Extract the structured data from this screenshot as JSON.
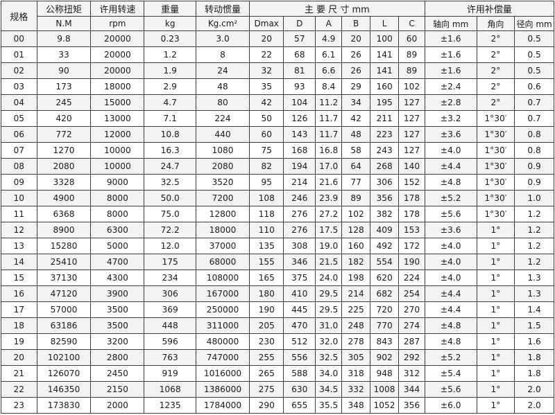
{
  "header": {
    "spec": "规格",
    "torque": "公称扭矩",
    "torque_unit": "N.M",
    "speed": "许用转速",
    "speed_unit": "rpm",
    "weight": "重量",
    "weight_unit": "kg",
    "inertia": "转动惯量",
    "inertia_unit": "Kg.cm²",
    "dims": "主 要 尺 寸 mm",
    "dims_cols": [
      "Dmax",
      "D",
      "A",
      "B",
      "L",
      "C"
    ],
    "comp": "许用补偿量",
    "comp_cols": [
      "轴向 mm",
      "角向",
      "径向 mm"
    ]
  },
  "rows": [
    [
      "00",
      "9.8",
      "20000",
      "0.23",
      "3.0",
      "20",
      "57",
      "4.9",
      "20",
      "100",
      "60",
      "±1.6",
      "2°",
      "0.5"
    ],
    [
      "01",
      "33",
      "20000",
      "1.2",
      "8",
      "22",
      "68",
      "6.1",
      "26",
      "141",
      "89",
      "±1.6",
      "2°",
      "0.5"
    ],
    [
      "02",
      "90",
      "20000",
      "1.9",
      "24",
      "32",
      "81",
      "6.6",
      "26",
      "141",
      "89",
      "±1.6",
      "2°",
      "0.5"
    ],
    [
      "03",
      "173",
      "18000",
      "2.9",
      "48",
      "35",
      "93",
      "8.4",
      "29",
      "160",
      "102",
      "±2.4",
      "2°",
      "0.6"
    ],
    [
      "04",
      "245",
      "15000",
      "4.7",
      "80",
      "42",
      "104",
      "11.2",
      "34",
      "195",
      "127",
      "±2.8",
      "2°",
      "0.7"
    ],
    [
      "05",
      "420",
      "13000",
      "7.1",
      "224",
      "50",
      "126",
      "11.7",
      "42",
      "211",
      "127",
      "±3.2",
      "1°30′",
      "0.7"
    ],
    [
      "06",
      "772",
      "12000",
      "10.8",
      "440",
      "60",
      "143",
      "11.7",
      "48",
      "223",
      "127",
      "±3.6",
      "1°30′",
      "0.8"
    ],
    [
      "07",
      "1270",
      "10000",
      "16.3",
      "1080",
      "75",
      "168",
      "16.8",
      "58",
      "243",
      "127",
      "±4.0",
      "1°30′",
      "0.8"
    ],
    [
      "08",
      "2080",
      "10000",
      "24.7",
      "2080",
      "82",
      "194",
      "17.0",
      "64",
      "268",
      "140",
      "±4.4",
      "1°30′",
      "0.9"
    ],
    [
      "09",
      "3328",
      "9000",
      "32.5",
      "3520",
      "95",
      "214",
      "21.6",
      "77",
      "306",
      "152",
      "±4.8",
      "1°30′",
      "0.9"
    ],
    [
      "10",
      "4900",
      "8000",
      "50.0",
      "7200",
      "108",
      "246",
      "23.9",
      "89",
      "356",
      "178",
      "±5.2",
      "1°30′",
      "1.0"
    ],
    [
      "11",
      "6368",
      "8000",
      "75.0",
      "12800",
      "118",
      "276",
      "27.2",
      "102",
      "382",
      "178",
      "±5.6",
      "1°30′",
      "1.2"
    ],
    [
      "12",
      "8900",
      "6300",
      "72.2",
      "18000",
      "110",
      "276",
      "17.5",
      "128",
      "409",
      "153",
      "±3.6",
      "1°",
      "1.2"
    ],
    [
      "13",
      "15280",
      "5000",
      "12.0",
      "37000",
      "135",
      "308",
      "19.0",
      "160",
      "492",
      "172",
      "±4.0",
      "1°",
      "1.2"
    ],
    [
      "14",
      "25410",
      "4700",
      "175",
      "68000",
      "155",
      "346",
      "21.5",
      "182",
      "554",
      "190",
      "±4.0",
      "1°",
      "1.2"
    ],
    [
      "15",
      "37130",
      "4300",
      "234",
      "108000",
      "165",
      "375",
      "24.0",
      "198",
      "620",
      "224",
      "±4.0",
      "1°",
      "1.3"
    ],
    [
      "16",
      "47120",
      "3900",
      "306",
      "167000",
      "180",
      "410",
      "29.5",
      "214",
      "682",
      "254",
      "±4.4",
      "1°",
      "1.3"
    ],
    [
      "17",
      "57000",
      "3500",
      "369",
      "250000",
      "190",
      "445",
      "29.5",
      "225",
      "720",
      "270",
      "±4.4",
      "1°",
      "1.4"
    ],
    [
      "18",
      "63186",
      "3500",
      "448",
      "311000",
      "205",
      "470",
      "31.0",
      "248",
      "770",
      "274",
      "±4.8",
      "1°",
      "1.5"
    ],
    [
      "19",
      "82590",
      "3200",
      "596",
      "480000",
      "230",
      "512",
      "32.0",
      "278",
      "843",
      "287",
      "±4.8",
      "1°",
      "1.6"
    ],
    [
      "20",
      "102100",
      "2800",
      "763",
      "747000",
      "255",
      "556",
      "32.5",
      "305",
      "902",
      "292",
      "±5.2",
      "1°",
      "1.8"
    ],
    [
      "21",
      "126070",
      "2450",
      "919",
      "1016000",
      "265",
      "588",
      "34.0",
      "318",
      "948",
      "312",
      "±5.4",
      "1°",
      "1.8"
    ],
    [
      "22",
      "146350",
      "2150",
      "1068",
      "1386000",
      "275",
      "630",
      "34.5",
      "332",
      "1008",
      "344",
      "±5.6",
      "1°",
      "2.0"
    ],
    [
      "23",
      "173830",
      "2000",
      "1235",
      "1784000",
      "290",
      "655",
      "35.5",
      "348",
      "1052",
      "356",
      "±6.0",
      "1°",
      "2.0"
    ]
  ]
}
